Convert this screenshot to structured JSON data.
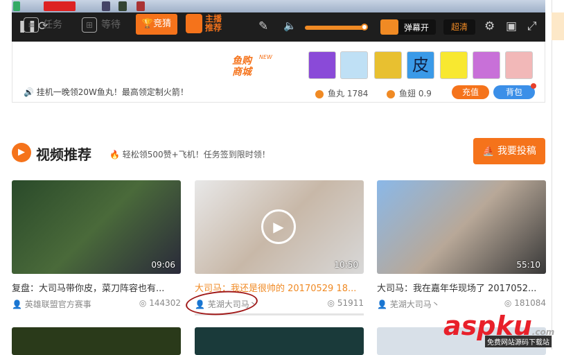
{
  "player": {
    "danmu_label": "弹幕开",
    "quality_label": "超清",
    "volume_percent": 95
  },
  "panel": {
    "task_label": "任务",
    "wait_label": "等待",
    "guess_label": "竞猜",
    "anchor_rec_label": "主播推荐",
    "fish_shop_label": "鱼购商城",
    "new_badge": "NEW",
    "notice": "挂机一晚领20W鱼丸！最高领定制火箭！",
    "fish_balls_label": "鱼丸",
    "fish_balls": "1784",
    "fish_fins_label": "鱼翅",
    "fish_fins": "0.9",
    "recharge_label": "充值",
    "bag_label": "背包"
  },
  "section": {
    "title": "视频推荐",
    "tip": "轻松领500赞+飞机！任务签到限时领！",
    "upload_label": "我要投稿"
  },
  "videos": [
    {
      "title": "复盘：大司马带你皮，菜刀阵容也有...",
      "author": "英雄联盟官方赛事",
      "views": "144302",
      "duration": "09:06"
    },
    {
      "title": "大司马：我还是很帅的 20170529 18...",
      "author": "芜湖大司马丶",
      "views": "51911",
      "duration": "10:50"
    },
    {
      "title": "大司马：我在嘉年华现场了 2017052...",
      "author": "芜湖大司马丶",
      "views": "181084",
      "duration": "55:10"
    }
  ],
  "watermark": {
    "brand": "aspku",
    "domain": ".com",
    "slogan": "免费网站源码下载站"
  },
  "colors": {
    "accent": "#f5731b",
    "blue": "#3b8fe8"
  }
}
